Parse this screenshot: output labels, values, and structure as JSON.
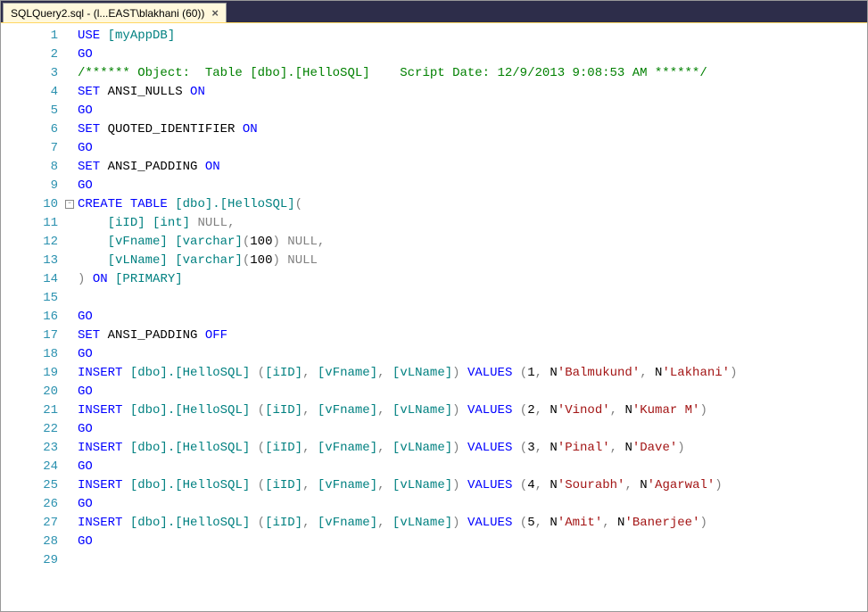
{
  "tab": {
    "label": "SQLQuery2.sql - (l...EAST\\blakhani (60))",
    "close": "×"
  },
  "code": {
    "line1_use": "USE",
    "line1_db": "[myAppDB]",
    "go": "GO",
    "line3_comment": "/****** Object:  Table [dbo].[HelloSQL]    Script Date: 12/9/2013 9:08:53 AM ******/",
    "line4_set": "SET",
    "line4_opt": " ANSI_NULLS ",
    "line4_on": "ON",
    "line6_set": "SET",
    "line6_opt": " QUOTED_IDENTIFIER ",
    "line6_on": "ON",
    "line8_set": "SET",
    "line8_opt": " ANSI_PADDING ",
    "line8_on": "ON",
    "line10_create": "CREATE",
    "line10_table": "TABLE",
    "line10_name": "[dbo].[HelloSQL]",
    "line11_col": "[iID]",
    "line11_type": "[int]",
    "line11_null": "NULL",
    "line12_col": "[vFname]",
    "line12_type": "[varchar]",
    "line12_size": "100",
    "line12_null": "NULL",
    "line13_col": "[vLName]",
    "line13_type": "[varchar]",
    "line13_size": "100",
    "line13_null": "NULL",
    "line14_on": "ON",
    "line14_primary": "[PRIMARY]",
    "line17_set": "SET",
    "line17_opt": " ANSI_PADDING ",
    "line17_off": "OFF",
    "insert": "INSERT",
    "dbo_hello": "[dbo].[HelloSQL]",
    "cols_iid": "[iID]",
    "cols_vfname": "[vFname]",
    "cols_vlname": "[vLName]",
    "values": "VALUES",
    "str_n": "N",
    "v1_id": "1",
    "v1_fn": "'Balmukund'",
    "v1_ln": "'Lakhani'",
    "v2_id": "2",
    "v2_fn": "'Vinod'",
    "v2_ln": "'Kumar M'",
    "v3_id": "3",
    "v3_fn": "'Pinal'",
    "v3_ln": "'Dave'",
    "v4_id": "4",
    "v4_fn": "'Sourabh'",
    "v4_ln": "'Agarwal'",
    "v5_id": "5",
    "v5_fn": "'Amit'",
    "v5_ln": "'Banerjee'",
    "fold_minus": "-"
  },
  "line_numbers": [
    "1",
    "2",
    "3",
    "4",
    "5",
    "6",
    "7",
    "8",
    "9",
    "10",
    "11",
    "12",
    "13",
    "14",
    "15",
    "16",
    "17",
    "18",
    "19",
    "20",
    "21",
    "22",
    "23",
    "24",
    "25",
    "26",
    "27",
    "28",
    "29"
  ]
}
